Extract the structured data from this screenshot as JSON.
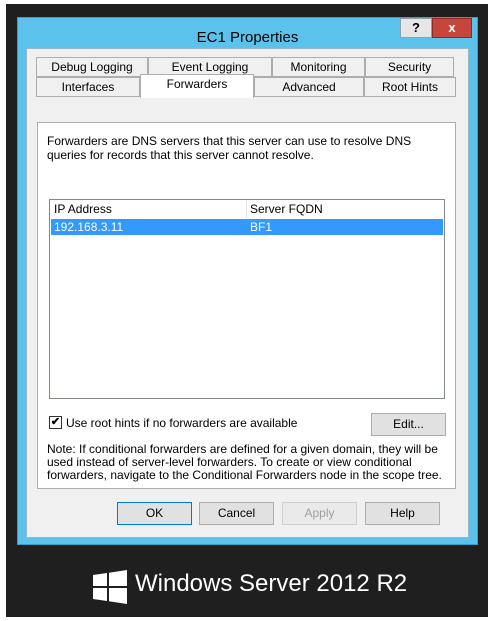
{
  "window": {
    "title": "EC1 Properties",
    "help": "?",
    "close": "x"
  },
  "tabs": {
    "row1": [
      "Debug Logging",
      "Event Logging",
      "Monitoring",
      "Security"
    ],
    "row2": [
      "Interfaces",
      "Forwarders",
      "Advanced",
      "Root Hints"
    ],
    "active": "Forwarders"
  },
  "panel": {
    "description": "Forwarders are DNS servers that this server can use to resolve DNS queries for records that this server cannot resolve.",
    "list": {
      "columns": [
        "IP Address",
        "Server FQDN"
      ],
      "rows": [
        {
          "ip": "192.168.3.11",
          "fqdn": "BF1",
          "selected": true
        }
      ]
    },
    "use_root_hints": {
      "label": "Use root hints if no forwarders are available",
      "checked": true,
      "mark": "✔"
    },
    "edit_label": "Edit...",
    "note": "Note: If conditional forwarders are defined for a given domain, they will be used instead of server-level forwarders.  To create or view conditional forwarders, navigate to the Conditional Forwarders node in the scope tree."
  },
  "buttons": {
    "ok": "OK",
    "cancel": "Cancel",
    "apply": "Apply",
    "help": "Help"
  },
  "branding": {
    "text": "Windows Server 2012 R2"
  },
  "colors": {
    "titlebar": "#5bc3eb",
    "selection": "#3399ff",
    "close": "#c7463b"
  }
}
